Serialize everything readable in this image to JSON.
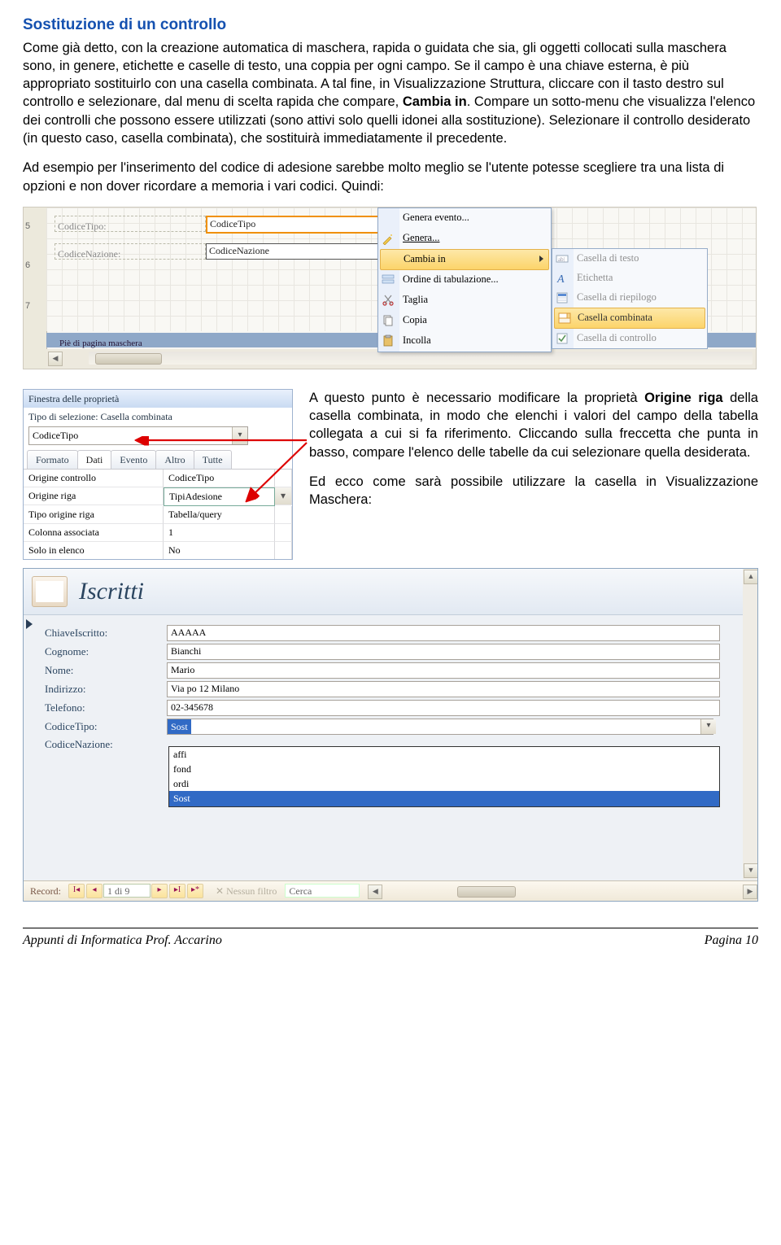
{
  "heading": "Sostituzione di un controllo",
  "para1_a": "Come già detto, con la creazione automatica di maschera, rapida o guidata che sia, gli oggetti collocati sulla maschera sono, in genere, etichette e caselle di testo, una coppia per ogni campo. Se il campo è una chiave esterna, è più appropriato sostituirlo con una casella combinata. A tal fine, in Visualizzazione Struttura, cliccare con il tasto destro sul controllo e selezionare, dal menu di scelta rapida che compare, ",
  "para1_b": "Cambia in",
  "para1_c": ". Compare un sotto-menu che visualizza l'elenco dei controlli che possono essere utilizzati (sono attivi solo quelli idonei alla sostituzione). Selezionare il controllo desiderato (in questo caso, casella combinata), che sostituirà immediatamente il precedente.",
  "para2": "Ad esempio per l'inserimento del codice di adesione sarebbe molto meglio se l'utente potesse scegliere tra una lista di opzioni e non dover ricordare a memoria i vari codici. Quindi:",
  "ss1": {
    "ruler": {
      "n5": "5",
      "n6": "6",
      "n7": "7"
    },
    "label1": "CodiceTipo:",
    "field1": "CodiceTipo",
    "label2": "CodiceNazione:",
    "field2": "CodiceNazione",
    "footer": "Piè di pagina maschera",
    "menu": {
      "m1": "Genera evento...",
      "m2": "Genera...",
      "m3": "Cambia in",
      "m4": "Ordine di tabulazione...",
      "m5": "Taglia",
      "m6": "Copia",
      "m7": "Incolla"
    },
    "submenu": {
      "s1": "Casella di testo",
      "s2": "Etichetta",
      "s3": "Casella di riepilogo",
      "s4": "Casella combinata",
      "s5": "Casella di controllo"
    }
  },
  "para3_a": "A questo punto è necessario modificare la proprietà ",
  "para3_b": "Origine riga",
  "para3_c": " della casella combinata, in modo che elenchi i valori del campo della tabella collegata a cui si fa riferimento. Cliccando sulla freccetta che punta in basso, compare l'elenco delle tabelle da cui selezionare quella desiderata.",
  "para4": "Ed ecco come sarà possibile utilizzare la casella in Visualizzazione Maschera:",
  "prop": {
    "title": "Finestra delle proprietà",
    "type": "Tipo di selezione:  Casella combinata",
    "ctl": "CodiceTipo",
    "tabs": {
      "t1": "Formato",
      "t2": "Dati",
      "t3": "Evento",
      "t4": "Altro",
      "t5": "Tutte"
    },
    "r1l": "Origine controllo",
    "r1v": "CodiceTipo",
    "r2l": "Origine riga",
    "r2v": "TipiAdesione",
    "r3l": "Tipo origine riga",
    "r3v": "Tabella/query",
    "r4l": "Colonna associata",
    "r4v": "1",
    "r5l": "Solo in elenco",
    "r5v": "No"
  },
  "form": {
    "title": "Iscritti",
    "rows": {
      "l1": "ChiaveIscritto:",
      "v1": "AAAAA",
      "l2": "Cognome:",
      "v2": "Bianchi",
      "l3": "Nome:",
      "v3": "Mario",
      "l4": "Indirizzo:",
      "v4": "Via po 12 Milano",
      "l5": "Telefono:",
      "v5": "02-345678",
      "l6": "CodiceTipo:",
      "v6": "Sost",
      "l7": "CodiceNazione:"
    },
    "drop": {
      "d1": "affi",
      "d2": "fond",
      "d3": "ordi",
      "d4": "Sost"
    },
    "nav": {
      "rec": "Record:",
      "page": "1 di 9",
      "nofilt": "Nessun filtro",
      "search": "Cerca"
    }
  },
  "footer": {
    "left": "Appunti di Informatica Prof. Accarino",
    "right": "Pagina 10"
  }
}
